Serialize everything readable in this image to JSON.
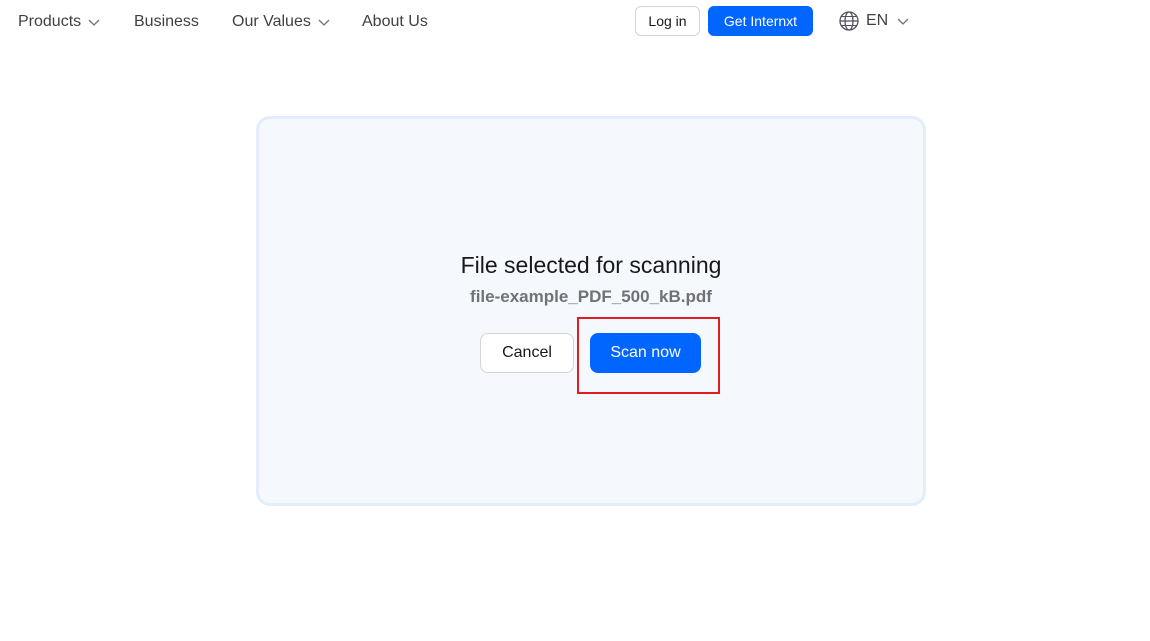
{
  "nav": {
    "items": [
      {
        "label": "Products",
        "has_dropdown": true
      },
      {
        "label": "Business",
        "has_dropdown": false
      },
      {
        "label": "Our Values",
        "has_dropdown": true
      },
      {
        "label": "About Us",
        "has_dropdown": false
      }
    ],
    "login_label": "Log in",
    "cta_label": "Get Internxt",
    "language": "EN",
    "language_icon": "globe-icon",
    "dropdown_icon": "chevron-down-icon"
  },
  "scanner": {
    "title": "File selected for scanning",
    "file_name": "file-example_PDF_500_kB.pdf",
    "cancel_label": "Cancel",
    "scan_label": "Scan now"
  },
  "colors": {
    "accent": "#0066ff",
    "card_bg": "#f5f8fd",
    "card_border": "#e3edfb",
    "highlight": "#e11d24"
  }
}
